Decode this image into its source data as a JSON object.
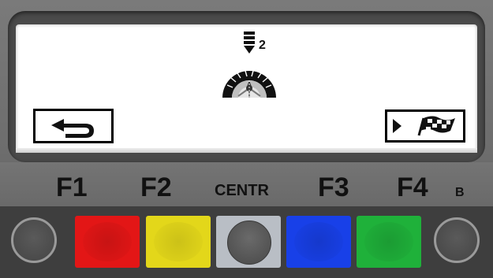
{
  "screen": {
    "wheel_indicator_number": "2",
    "wheel_icon": "wheel-weight-position-icon",
    "back_icon": "undo-arrow-icon",
    "next_icon": "checkered-flag-icon"
  },
  "labels": {
    "f1": "F1",
    "f2": "F2",
    "centr": "CENTR",
    "f3": "F3",
    "f4": "F4",
    "b": "B"
  },
  "buttons": {
    "colors": {
      "f1": "#e31616",
      "f2": "#e3d71a",
      "centr": "#b9bec5",
      "f3": "#1840e8",
      "f4": "#1fb13a"
    }
  }
}
